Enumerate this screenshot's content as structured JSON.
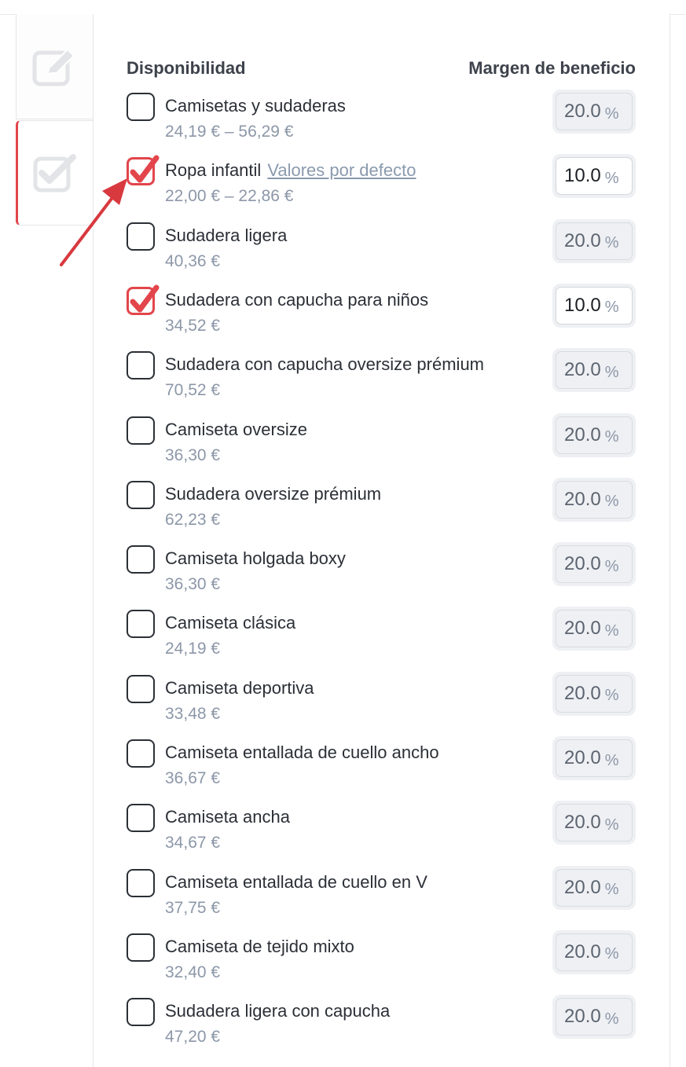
{
  "header": {
    "availability_label": "Disponibilidad",
    "margin_label": "Margen de beneficio"
  },
  "tabs": [
    {
      "name": "edit",
      "icon": "edit-icon"
    },
    {
      "name": "availability",
      "icon": "checkbox-icon",
      "active": true
    }
  ],
  "colors": {
    "accent": "#e2454b",
    "link": "#8a9aae",
    "price": "#8c97a8"
  },
  "products": [
    {
      "name": "Camisetas y sudaderas",
      "price": "24,19 € – 56,29 €",
      "checked": false,
      "margin": "20.0",
      "unit": "%"
    },
    {
      "name": "Ropa infantil",
      "link": "Valores por defecto",
      "price": "22,00 € – 22,86 €",
      "checked": true,
      "margin": "10.0",
      "unit": "%"
    },
    {
      "name": "Sudadera ligera",
      "price": "40,36 €",
      "checked": false,
      "margin": "20.0",
      "unit": "%"
    },
    {
      "name": "Sudadera con capucha para niños",
      "price": "34,52 €",
      "checked": true,
      "margin": "10.0",
      "unit": "%"
    },
    {
      "name": "Sudadera con capucha oversize prémium",
      "price": "70,52 €",
      "checked": false,
      "margin": "20.0",
      "unit": "%"
    },
    {
      "name": "Camiseta oversize",
      "price": "36,30 €",
      "checked": false,
      "margin": "20.0",
      "unit": "%"
    },
    {
      "name": "Sudadera oversize prémium",
      "price": "62,23 €",
      "checked": false,
      "margin": "20.0",
      "unit": "%"
    },
    {
      "name": "Camiseta holgada boxy",
      "price": "36,30 €",
      "checked": false,
      "margin": "20.0",
      "unit": "%"
    },
    {
      "name": "Camiseta clásica",
      "price": "24,19 €",
      "checked": false,
      "margin": "20.0",
      "unit": "%"
    },
    {
      "name": "Camiseta deportiva",
      "price": "33,48 €",
      "checked": false,
      "margin": "20.0",
      "unit": "%"
    },
    {
      "name": "Camiseta entallada de cuello ancho",
      "price": "36,67 €",
      "checked": false,
      "margin": "20.0",
      "unit": "%"
    },
    {
      "name": "Camiseta ancha",
      "price": "34,67 €",
      "checked": false,
      "margin": "20.0",
      "unit": "%"
    },
    {
      "name": "Camiseta entallada de cuello en V",
      "price": "37,75 €",
      "checked": false,
      "margin": "20.0",
      "unit": "%"
    },
    {
      "name": "Camiseta de tejido mixto",
      "price": "32,40 €",
      "checked": false,
      "margin": "20.0",
      "unit": "%"
    },
    {
      "name": "Sudadera ligera con capucha",
      "price": "47,20 €",
      "checked": false,
      "margin": "20.0",
      "unit": "%"
    }
  ]
}
